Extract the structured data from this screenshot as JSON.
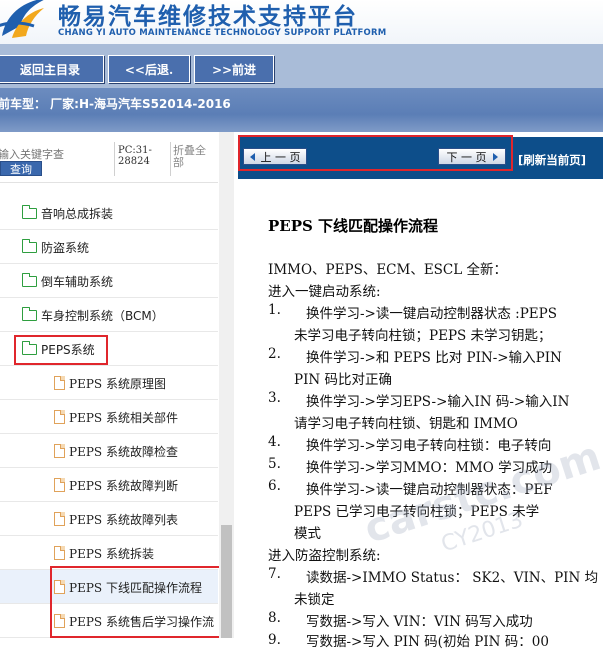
{
  "header": {
    "title_cn": "畅易汽车维修技术支持平台",
    "title_en": "CHANG YI AUTO MAINTENANCE TECHNOLOGY SUPPORT PLATFORM"
  },
  "nav": {
    "home": "返回主目录",
    "back": "<<后退.",
    "forward": ">>前进"
  },
  "model": {
    "text": "前车型： 厂家:H-海马汽车S52014-2016"
  },
  "sidebar": {
    "search_placeholder": "输入关键字查",
    "search_button": "查询",
    "pc_code": "PC:31-28824",
    "collapse_all": "折叠全部",
    "items": [
      {
        "type": "folder",
        "label": "音响总成拆装"
      },
      {
        "type": "folder",
        "label": "防盗系统"
      },
      {
        "type": "folder",
        "label": "倒车辅助系统"
      },
      {
        "type": "folder",
        "label": "车身控制系统（BCM）"
      },
      {
        "type": "folder",
        "label": "PEPS系统"
      },
      {
        "type": "page",
        "label": "PEPS 系统原理图"
      },
      {
        "type": "page",
        "label": "PEPS 系统相关部件"
      },
      {
        "type": "page",
        "label": "PEPS 系统故障检查"
      },
      {
        "type": "page",
        "label": "PEPS 系统故障判断"
      },
      {
        "type": "page",
        "label": "PEPS 系统故障列表"
      },
      {
        "type": "page",
        "label": "PEPS 系统拆装"
      },
      {
        "type": "page",
        "label": "PEPS 下线匹配操作流程"
      },
      {
        "type": "page",
        "label": "PEPS 系统售后学习操作流"
      }
    ]
  },
  "viewer": {
    "prev_page": "上 一 页",
    "next_page": "下 一 页",
    "refresh": "[刷新当前页]"
  },
  "document": {
    "title": "PEPS  下线匹配操作流程",
    "lines": [
      "IMMO、PEPS、ECM、ESCL  全新：",
      "进入一键启动系统:",
      "换件学习->读一键启动控制器状态 :PEPS",
      "未学习电子转向柱锁；PEPS  未学习钥匙；",
      "换件学习->和 PEPS  比对 PIN->输入PIN",
      "PIN  码比对正确",
      "换件学习->学习EPS->输入IN  码->输入IN",
      "请学习电子转向柱锁、钥匙和 IMMO",
      "换件学习->学习电子转向柱锁：电子转向",
      "换件学习->学习MMO：MMO  学习成功",
      "换件学习->读一键启动控制器状态：PEF",
      "PEPS  已学习电子转向柱锁；PEPS  未学",
      "模式",
      "进入防盗控制系统:",
      "读数据->IMMO Status： SK2、VIN、PIN  均",
      "未锁定",
      "写数据->写入 VIN：VIN  码写入成功",
      "写数据->写入 PIN  码(初始 PIN  码：00"
    ],
    "numbers": [
      "1.",
      "2.",
      "3.",
      "4.",
      "5.",
      "6.",
      "7.",
      "8.",
      "9."
    ]
  },
  "watermark": {
    "text1": "carstc.com",
    "text2": "CY2013"
  },
  "colors": {
    "brand_blue": "#1f5fae",
    "nav_button": "#4a6fad",
    "toolbar_dark": "#0d4e8a",
    "highlight_red": "#e0262c",
    "folder_green": "#2e9e3f"
  }
}
